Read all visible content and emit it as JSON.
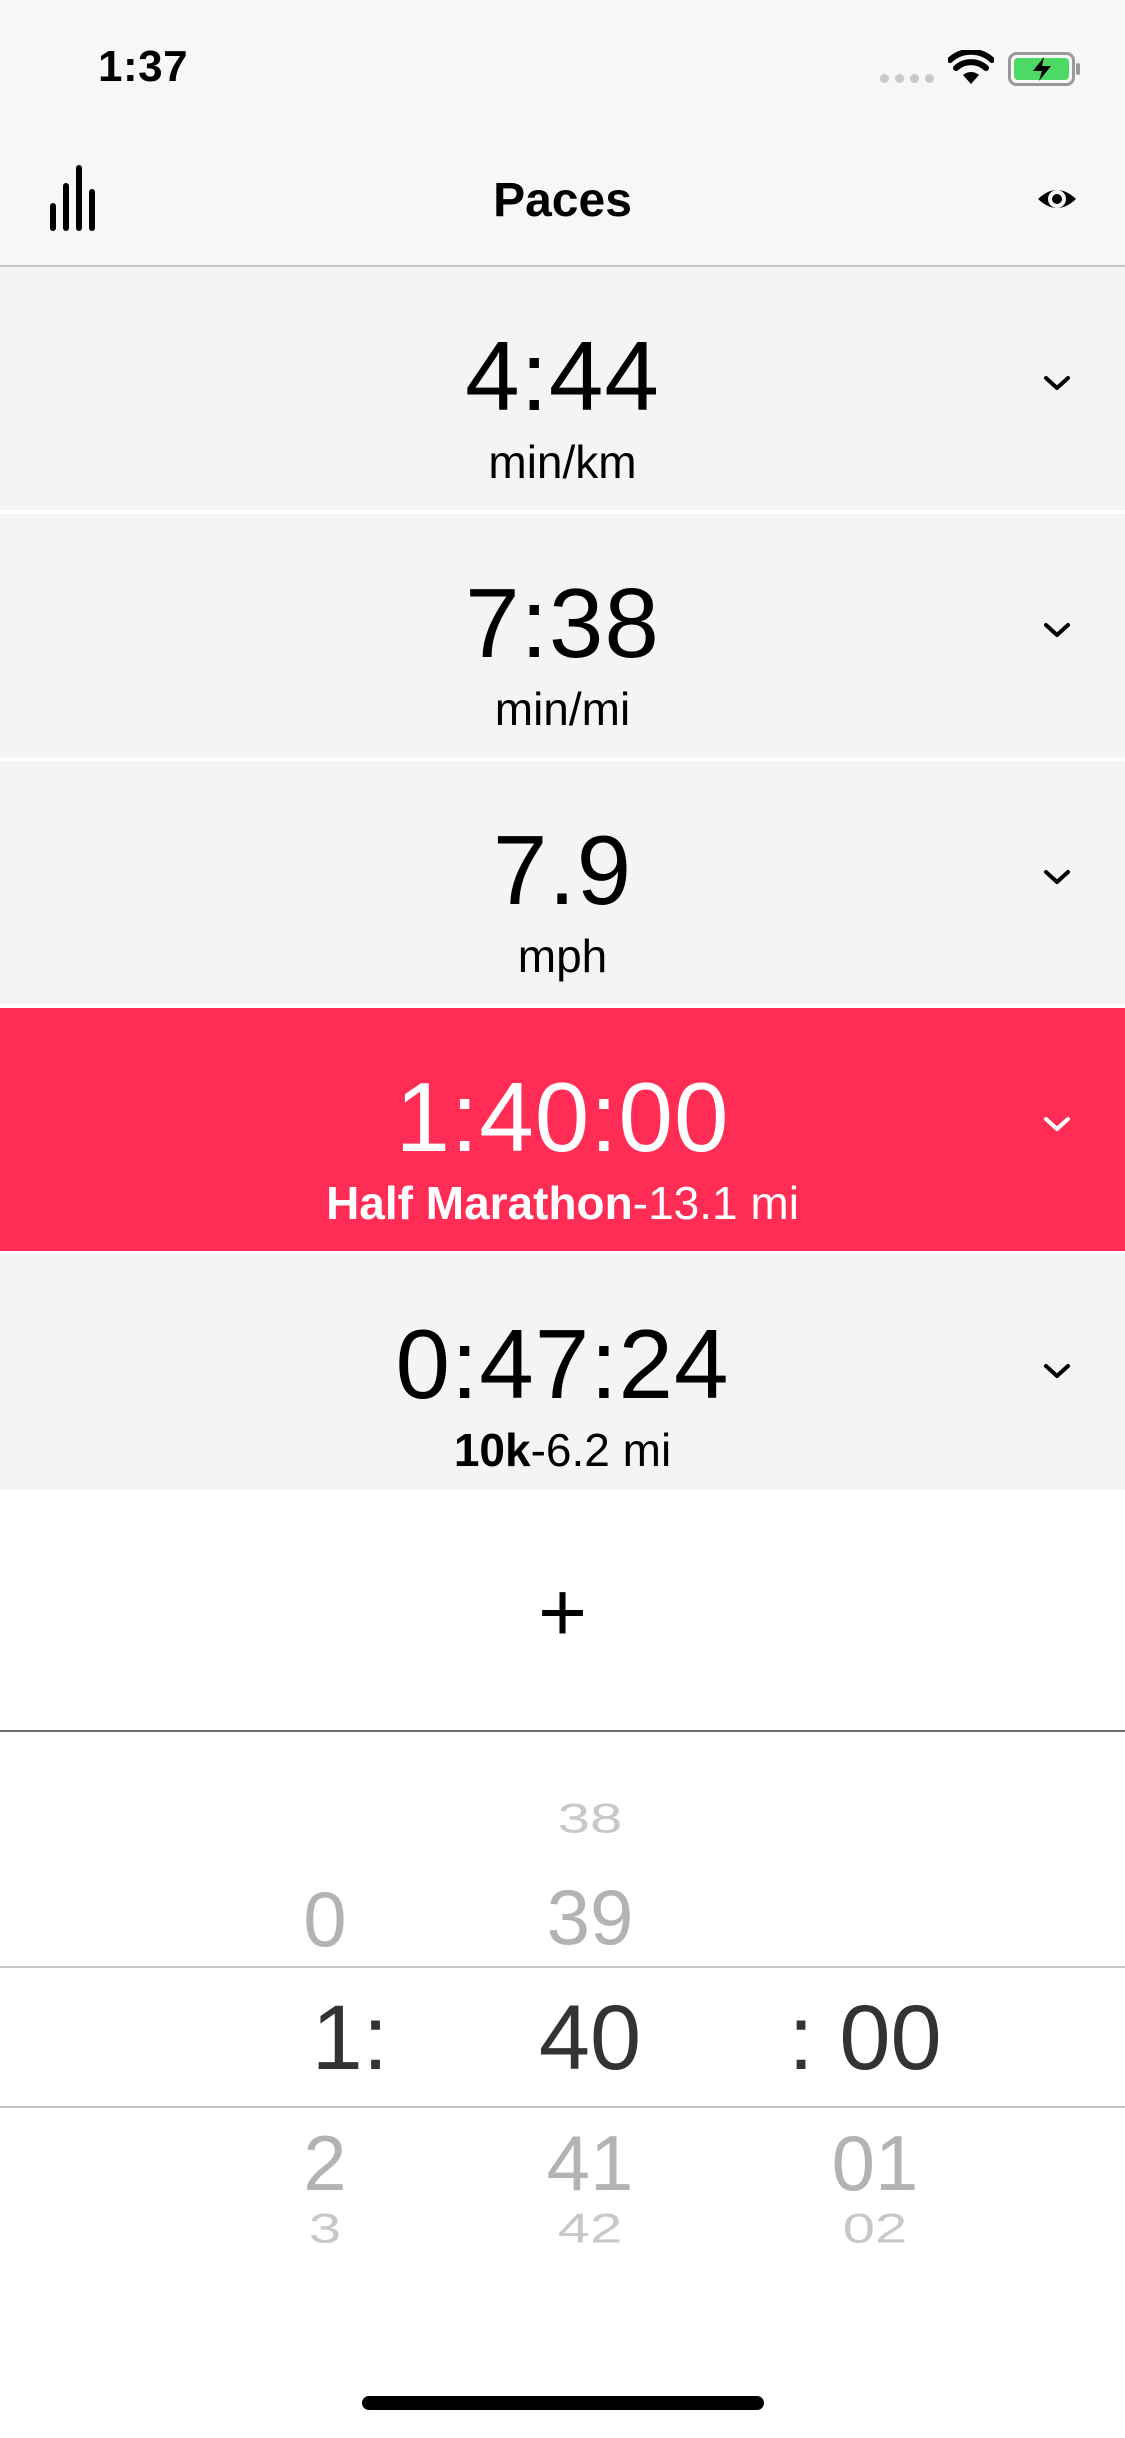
{
  "status_bar": {
    "time": "1:37"
  },
  "nav": {
    "title": "Paces",
    "left_icon": "bar-chart-icon",
    "right_icon": "eye-icon"
  },
  "rows": [
    {
      "value": "4:44",
      "unit": "min/km"
    },
    {
      "value": "7:38",
      "unit": "min/mi"
    },
    {
      "value": "7.9",
      "unit": "mph"
    },
    {
      "value": "1:40:00",
      "race": "Half Marathon",
      "distance": "-13.1 mi",
      "selected": true
    },
    {
      "value": "0:47:24",
      "race": "10k",
      "distance": "-6.2 mi"
    }
  ],
  "add_button": {
    "label": "+"
  },
  "picker": {
    "hours": {
      "above": [
        "0"
      ],
      "selected": "1:",
      "below": [
        "2",
        "3"
      ]
    },
    "minutes": {
      "above": [
        "38",
        "39"
      ],
      "selected": "40",
      "below": [
        "41",
        "42"
      ]
    },
    "seconds": {
      "above": [],
      "selected": ": 00",
      "below": [
        "01",
        "02"
      ]
    }
  },
  "colors": {
    "accent": "#ff2d55",
    "row_bg": "#f4f4f4",
    "battery": "#4cd964"
  }
}
